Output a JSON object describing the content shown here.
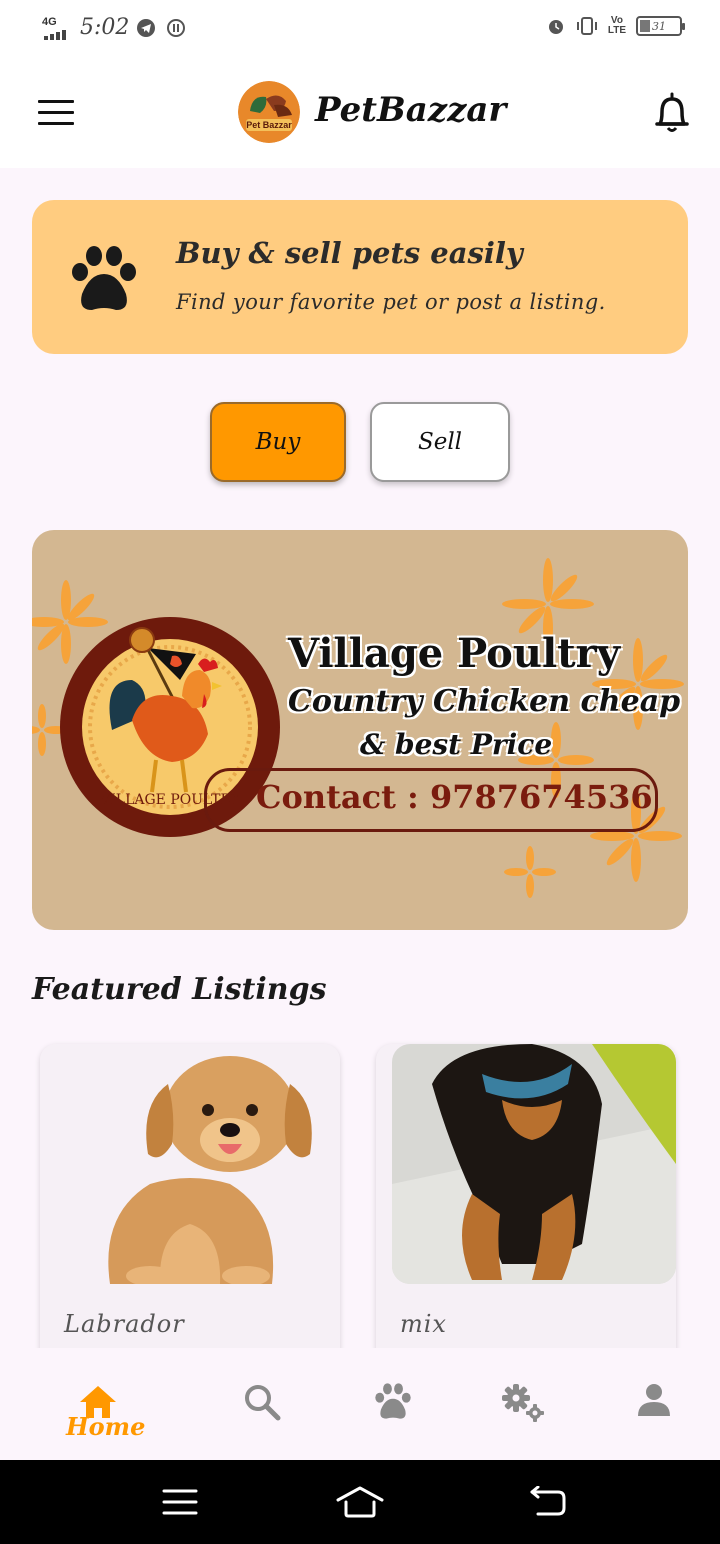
{
  "status_bar": {
    "network": "4G",
    "time": "5:02",
    "volte_line1": "Vo",
    "volte_line2": "LTE",
    "battery": "31"
  },
  "app_bar": {
    "title": "PetBazzar",
    "logo_text": "Pet Bazzar",
    "menu_icon": "hamburger-icon",
    "notification_icon": "bell-icon"
  },
  "hero": {
    "title": "Buy & sell pets easily",
    "subtitle": "Find your favorite pet or post a listing.",
    "icon": "paw-icon",
    "background": "#ffcc80"
  },
  "actions": {
    "buy_label": "Buy",
    "sell_label": "Sell",
    "buy_color": "#ff9800"
  },
  "banner": {
    "title": "Village Poultry",
    "line2": "Country Chicken cheap",
    "line3": "& best Price",
    "contact": "Contact : 9787674536",
    "seal_text": "VILLAGE POULTRY"
  },
  "featured": {
    "heading": "Featured Listings",
    "listings": [
      {
        "name": "Labrador"
      },
      {
        "name": "mix"
      }
    ]
  },
  "bottom_nav": {
    "items": [
      {
        "label": "Home",
        "icon": "home-icon",
        "active": true
      },
      {
        "label": "",
        "icon": "search-icon",
        "active": false
      },
      {
        "label": "",
        "icon": "paw-icon",
        "active": false
      },
      {
        "label": "",
        "icon": "settings-icon",
        "active": false
      },
      {
        "label": "",
        "icon": "profile-icon",
        "active": false
      }
    ],
    "active_color": "#ff9800",
    "inactive_color": "#8a8a8a"
  }
}
